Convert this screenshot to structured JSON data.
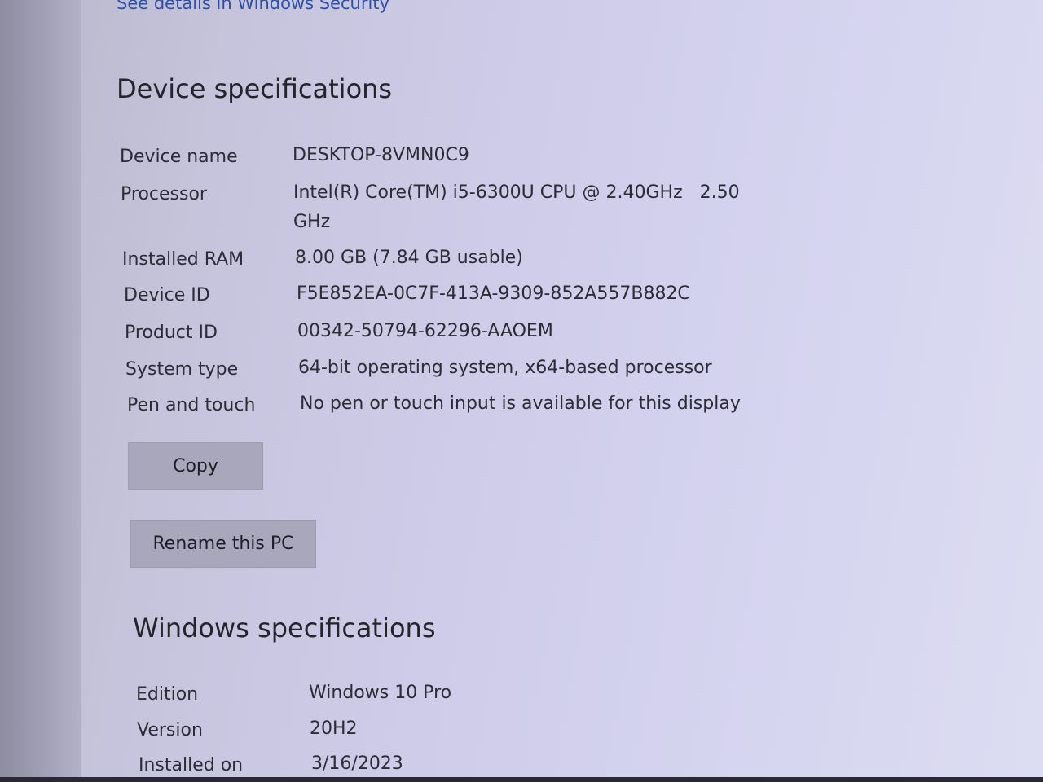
{
  "security_link": "See details in Windows Security",
  "device_specs": {
    "title": "Device specifications",
    "rows": [
      {
        "label": "Device name",
        "value": "DESKTOP-8VMN0C9"
      },
      {
        "label": "Processor",
        "value_line1": "Intel(R) Core(TM) i5-6300U CPU @ 2.40GHz   2.50",
        "value_line2": "GHz"
      },
      {
        "label": "Installed RAM",
        "value": "8.00 GB (7.84 GB usable)"
      },
      {
        "label": "Device ID",
        "value": "F5E852EA-0C7F-413A-9309-852A557B882C"
      },
      {
        "label": "Product ID",
        "value": "00342-50794-62296-AAOEM"
      },
      {
        "label": "System type",
        "value": "64-bit operating system, x64-based processor"
      },
      {
        "label": "Pen and touch",
        "value": "No pen or touch input is available for this display"
      }
    ],
    "copy_label": "Copy",
    "rename_label": "Rename this PC"
  },
  "windows_specs": {
    "title": "Windows specifications",
    "rows": [
      {
        "label": "Edition",
        "value": "Windows 10 Pro"
      },
      {
        "label": "Version",
        "value": "20H2"
      },
      {
        "label": "Installed on",
        "value": "3/16/2023"
      }
    ]
  }
}
